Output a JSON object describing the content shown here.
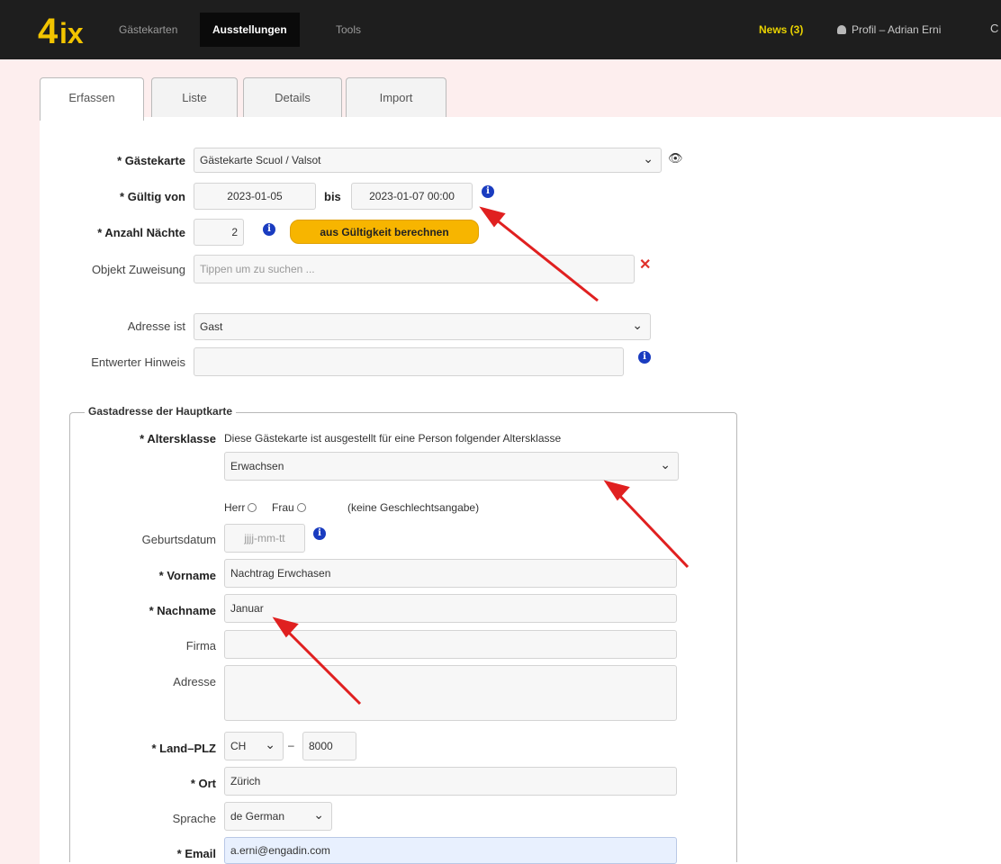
{
  "topbar": {
    "nav": [
      "Gästekarten",
      "Ausstellungen",
      "Tools"
    ],
    "news": "News (3)",
    "profile": "Profil – Adrian Erni",
    "extra": "C"
  },
  "tabs": [
    "Erfassen",
    "Liste",
    "Details",
    "Import"
  ],
  "form": {
    "gaestekarte": {
      "label": "Gästekarte",
      "value": "Gästekarte Scuol / Valsot"
    },
    "gueltig": {
      "label": "Gültig von",
      "from": "2023-01-05",
      "bis_label": "bis",
      "to": "2023-01-07 00:00"
    },
    "naechte": {
      "label": "Anzahl Nächte",
      "value": "2",
      "button": "aus Gültigkeit berechnen"
    },
    "objekt": {
      "label": "Objekt Zuweisung",
      "placeholder": "Tippen um zu suchen ..."
    },
    "adresse_ist": {
      "label": "Adresse ist",
      "value": "Gast"
    },
    "entwerter": {
      "label": "Entwerter Hinweis",
      "value": ""
    }
  },
  "gastadresse": {
    "legend": "Gastadresse der Hauptkarte",
    "altersklasse_label": "Altersklasse",
    "altersklasse_text": "Diese Gästekarte ist ausgestellt für eine Person folgender Altersklasse",
    "altersklasse_value": "Erwachsen",
    "herr": "Herr",
    "frau": "Frau",
    "keine": "(keine Geschlechtsangabe)",
    "geburtsdatum_label": "Geburtsdatum",
    "geburtsdatum_placeholder": "jjjj-mm-tt",
    "vorname_label": "Vorname",
    "vorname_value": "Nachtrag  Erwchasen",
    "nachname_label": "Nachname",
    "nachname_value": "Januar",
    "firma_label": "Firma",
    "adresse_label": "Adresse",
    "land_plz_label": "Land–PLZ",
    "land_value": "CH",
    "dash": "–",
    "plz_value": "8000",
    "ort_label": "Ort",
    "ort_value": "Zürich",
    "sprache_label": "Sprache",
    "sprache_value": "de German",
    "email_label": "Email",
    "email_value": "a.erni@engadin.com"
  },
  "colors": {
    "accent_button": "#f7b500",
    "topbar": "#1e1e1e",
    "info": "#1a3cc0",
    "arrow": "#e02020",
    "news": "#e9d200"
  }
}
